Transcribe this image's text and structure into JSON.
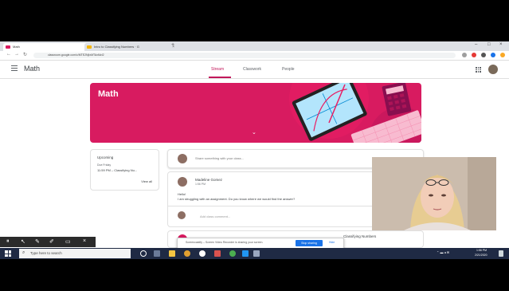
{
  "browser": {
    "tabs": [
      {
        "label": "Math",
        "active": true
      },
      {
        "label": "Intro to Classifying Numbers · G",
        "active": false
      }
    ],
    "new_tab": "+",
    "url": "classroom.google.com/c/MTE2NjIxMTAxMzI2"
  },
  "classroom": {
    "class_title": "Math",
    "tabs": [
      "Stream",
      "Classwork",
      "People"
    ],
    "active_tab": "Stream",
    "accent_color": "#c2185b"
  },
  "banner": {
    "title": "Math",
    "color": "#d81b60"
  },
  "upcoming": {
    "heading": "Upcoming",
    "due": "Due Friday",
    "item": "11:59 PM – Classifying Nu...",
    "view_all": "View all"
  },
  "share": {
    "placeholder": "Share something with your class..."
  },
  "post": {
    "author": "Madeline Gomez",
    "time": "1:56 PM",
    "line1": "Hello!",
    "line2": "I am struggling with an assignment. Do you know where we would find the answer?",
    "comment_placeholder": "Add class comment..."
  },
  "post2": {
    "text": "Classifying Numbers"
  },
  "notification": {
    "message": "Screencastify – Screen Video Recorder is sharing your screen.",
    "stop_button": "Stop sharing",
    "hide": "Hide"
  },
  "taskbar": {
    "search_placeholder": "Type here to search",
    "time": "1:56 PM",
    "date": "2/21/2020"
  }
}
